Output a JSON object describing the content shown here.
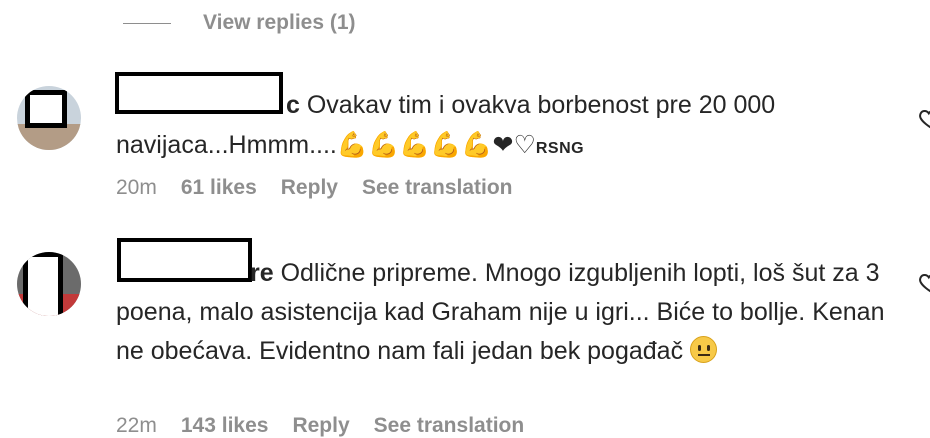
{
  "view_replies": {
    "label": "View replies (1)"
  },
  "comments": [
    {
      "username_tail": "c",
      "text": " Ovakav tim i ovakva borbenost pre 20 000 navijaca...Hmmm....",
      "emoji_suffix": "💪💪💪💪💪❤♡",
      "tag": "RSNG",
      "time": "20m",
      "likes": "61 likes",
      "reply": "Reply",
      "translate": "See translation"
    },
    {
      "username_tail": "re",
      "text": " Odlične pripreme. Mnogo izgubljenih lopti, loš šut za 3 poena, malo asistencija kad Graham nije u igri... Biće to bollje. Kenan ne obećava. Evidentno nam fali jedan bek pogađač",
      "emoji_name": "neutral-face",
      "time": "22m",
      "likes": "143 likes",
      "reply": "Reply",
      "translate": "See translation"
    }
  ]
}
